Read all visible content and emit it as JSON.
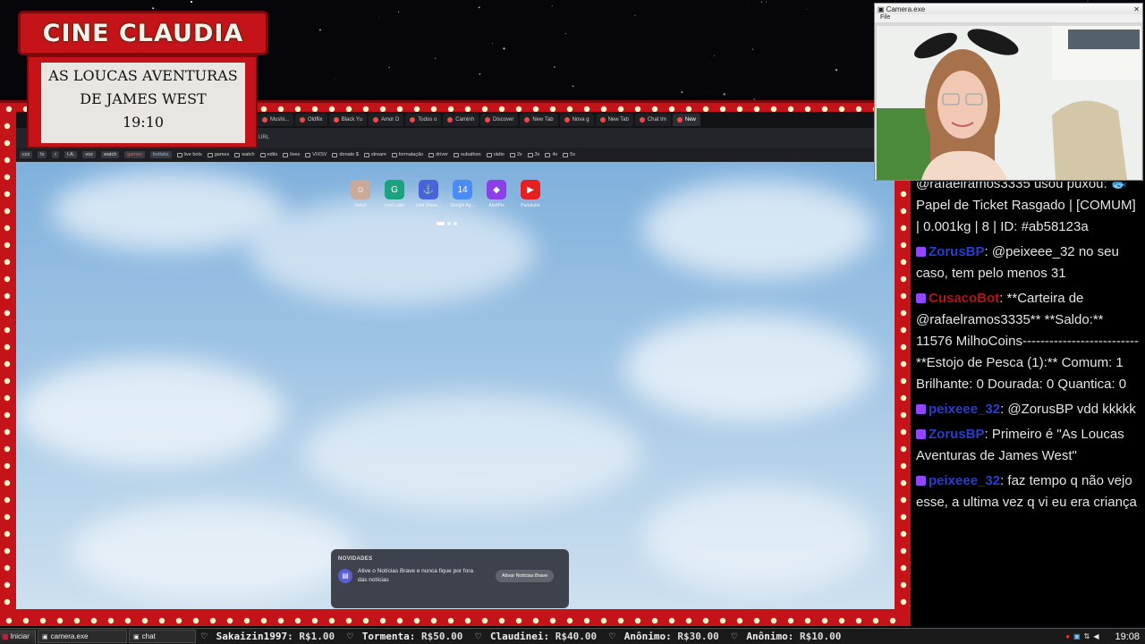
{
  "logo": {
    "text": "CINE CLAUDIA"
  },
  "poster": {
    "line1": "AS LOUCAS AVENTURAS",
    "line2": "DE JAMES WEST",
    "time": "19:10"
  },
  "browser": {
    "tabs": [
      "Mushi...",
      "Oldflix",
      "Black Yu",
      "Amor D",
      "Todos o",
      "Caminh",
      "Discover",
      "New Tab",
      "Nova g",
      "New Tab",
      "Chat Im",
      "New"
    ],
    "url": "URL",
    "bookmarks": [
      "ccz",
      "lv",
      "r",
      "t.A.",
      "voz",
      "watch",
      "games",
      "botlabs",
      "live bots",
      "games",
      "watch",
      "edits",
      "lives",
      "VIXSV",
      "donate $",
      "stream",
      "formatação",
      "driver",
      "subathon",
      "rádio",
      "2x",
      "3x",
      "4x",
      "5x"
    ],
    "shortcuts": [
      {
        "label": "Twitch",
        "icon": "avatar-icon",
        "color": "#c9a99a"
      },
      {
        "label": "cmd Labs",
        "icon": "g-icon",
        "color": "#1ba37f"
      },
      {
        "label": "cmd Ueme...",
        "icon": "anchor-icon",
        "color": "#4a63d8"
      },
      {
        "label": "Google Ag...",
        "icon": "calendar-icon",
        "color": "#4a8bf5"
      },
      {
        "label": "AlertPix",
        "icon": "pix-icon",
        "color": "#8b3fe6"
      },
      {
        "label": "Parlatube",
        "icon": "play-icon",
        "color": "#e62020"
      }
    ],
    "news": {
      "heading": "NOVIDADES",
      "text": "Ative o Notícias Brave e nunca fique por fora das notícias",
      "button": "Ativar Notícias Brave"
    }
  },
  "camera": {
    "title": "Camera.exe",
    "menu": "File"
  },
  "chat": {
    "messages": [
      {
        "parts": [
          {
            "t": "@rafaelramos3335 usou ",
            "c": "#e4e4e4"
          },
          {
            "t": "puxou: 🐟 Papel de Ticket Rasgado | [COMUM] | 0.001kg | 8 | ID: #ab58123a",
            "c": "#e4e4e4"
          }
        ]
      },
      {
        "badge": "#9146ff",
        "name": "ZorusBP",
        "nameColor": "#2b3cd0",
        "text": ": @peixeee_32 no seu caso, tem pelo menos 31"
      },
      {
        "badge": "#9146ff",
        "name": "CusacoBot",
        "nameColor": "#b3141a",
        "text": ": **Carteira de @rafaelramos3335** **Saldo:** 11576 MilhoCoins-------------------------- **Estojo de Pesca (1):** Comum: 1 Brilhante: 0 Dourada: 0 Quantica: 0"
      },
      {
        "badge": "#9146ff",
        "name": "peixeee_32",
        "nameColor": "#2b3cd0",
        "text": ": @ZorusBP vdd kkkkk"
      },
      {
        "badge": "#9146ff",
        "name": "ZorusBP",
        "nameColor": "#2b3cd0",
        "text": ": Primeiro é \"As Loucas Aventuras de James West\""
      },
      {
        "badge": "#9146ff",
        "name": "peixeee_32",
        "nameColor": "#2b3cd0",
        "text": ": faz tempo q não vejo esse, a ultima vez q vi eu era criança"
      }
    ]
  },
  "taskbar": {
    "start": "Iniciar",
    "tasks": [
      "camera.exe",
      "chat"
    ],
    "ticker": [
      {
        "name": "Sakaizin1997:",
        "amount": "R$1.00"
      },
      {
        "name": "Tormenta:",
        "amount": "R$50.00"
      },
      {
        "name": "Claudinei:",
        "amount": "R$40.00"
      },
      {
        "name": "Anônimo:",
        "amount": "R$30.00"
      },
      {
        "name": "Anônimo:",
        "amount": "R$10.00"
      }
    ],
    "clock": "19:08"
  },
  "colors": {
    "frame": "#c4141a",
    "frame_dark": "#7a0a0e",
    "bulb": "#fff3c9",
    "sky": "#8fbbe0"
  }
}
